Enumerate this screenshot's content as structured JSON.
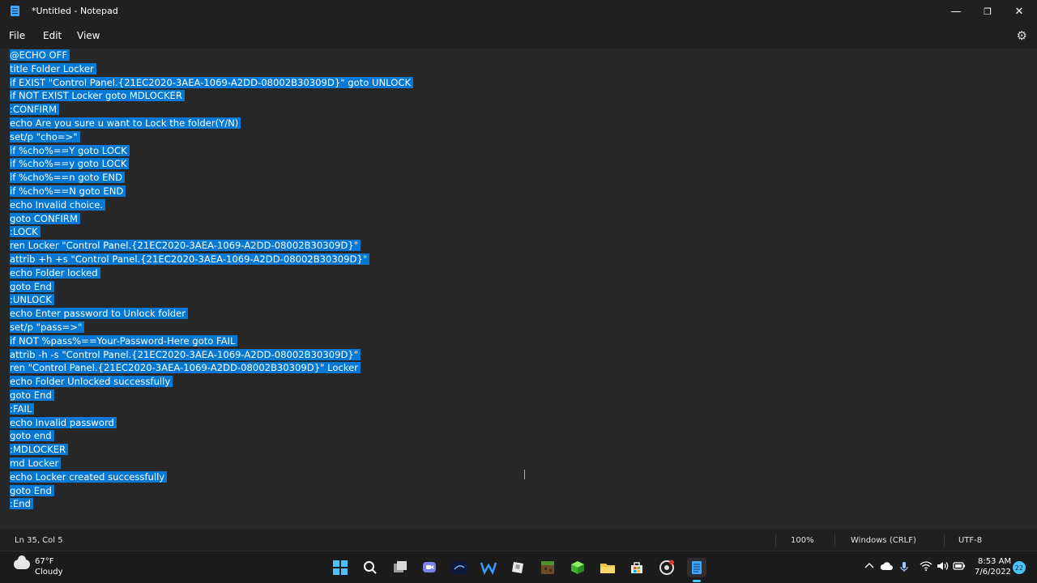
{
  "window": {
    "title": "*Untitled - Notepad",
    "minimize_glyph": "—",
    "maximize_glyph": "❐",
    "close_glyph": "✕"
  },
  "menu": {
    "file": "File",
    "edit": "Edit",
    "view": "View",
    "settings_icon": "⚙"
  },
  "editor": {
    "selection_color": "#0078d4",
    "lines": [
      "@ECHO OFF",
      "title Folder Locker",
      "if EXIST \"Control Panel.{21EC2020-3AEA-1069-A2DD-08002B30309D}\" goto UNLOCK",
      "if NOT EXIST Locker goto MDLOCKER",
      ":CONFIRM",
      "echo Are you sure u want to Lock the folder(Y/N)",
      "set/p \"cho=>\"",
      "if %cho%==Y goto LOCK",
      "if %cho%==y goto LOCK",
      "if %cho%==n goto END",
      "if %cho%==N goto END",
      "echo Invalid choice.",
      "goto CONFIRM",
      ":LOCK",
      "ren Locker \"Control Panel.{21EC2020-3AEA-1069-A2DD-08002B30309D}\"",
      "attrib +h +s \"Control Panel.{21EC2020-3AEA-1069-A2DD-08002B30309D}\"",
      "echo Folder locked",
      "goto End",
      ":UNLOCK",
      "echo Enter password to Unlock folder",
      "set/p \"pass=>\"",
      "if NOT %pass%==Your-Password-Here goto FAIL",
      "attrib -h -s \"Control Panel.{21EC2020-3AEA-1069-A2DD-08002B30309D}\"",
      "ren \"Control Panel.{21EC2020-3AEA-1069-A2DD-08002B30309D}\" Locker",
      "echo Folder Unlocked successfully",
      "goto End",
      ":FAIL",
      "echo Invalid password",
      "goto end",
      ":MDLOCKER",
      "md Locker",
      "echo Locker created successfully",
      "goto End",
      ":End"
    ]
  },
  "status": {
    "position": "Ln 35, Col 5",
    "zoom": "100%",
    "line_ending": "Windows (CRLF)",
    "encoding": "UTF-8"
  },
  "taskbar": {
    "weather_temp": "67°F",
    "weather_desc": "Cloudy",
    "time": "8:53 AM",
    "date": "7/6/2022",
    "notification_count": "22",
    "accent_color": "#4cc2ff"
  }
}
